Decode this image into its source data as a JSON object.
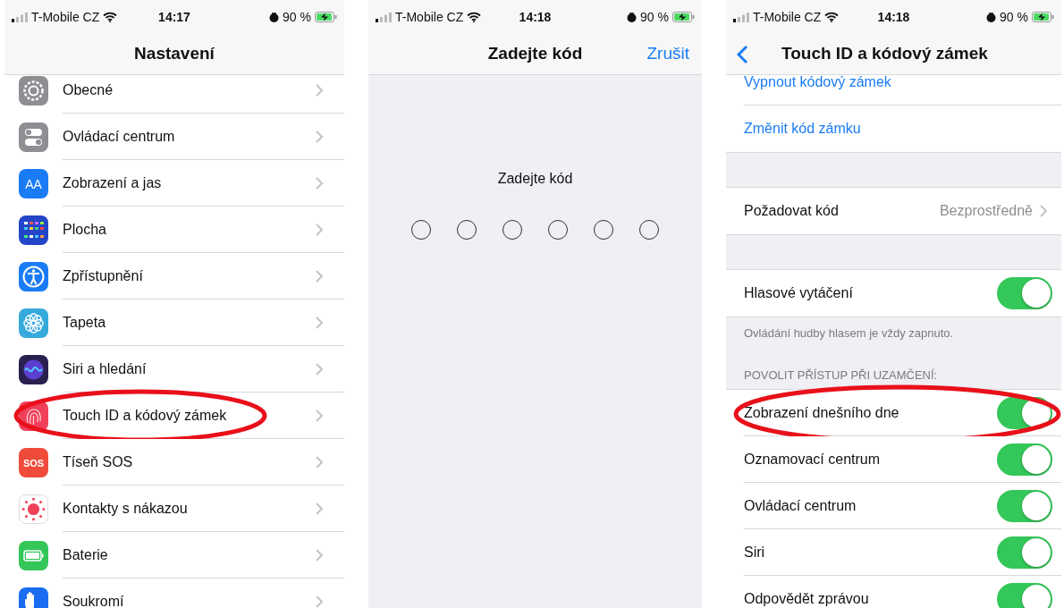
{
  "screens": [
    {
      "kind": "settings",
      "status_bar": {
        "carrier": "T-Mobile CZ",
        "time": "14:17",
        "battery": "90 %"
      },
      "title": "Nastavení",
      "items": [
        {
          "label": "Obecné",
          "color": "#8e8e93",
          "highlighted": false
        },
        {
          "label": "Ovládací centrum",
          "color": "#8e8e93",
          "highlighted": false
        },
        {
          "label": "Zobrazení a jas",
          "color": "#1a7cf5",
          "icon_text": "AA",
          "highlighted": false
        },
        {
          "label": "Plocha",
          "color": "#2346c9",
          "highlighted": false
        },
        {
          "label": "Zpřístupnění",
          "color": "#1a7cf5",
          "highlighted": false
        },
        {
          "label": "Tapeta",
          "color": "#36aadc",
          "highlighted": false
        },
        {
          "label": "Siri a hledání",
          "color": "#2a2050",
          "highlighted": false
        },
        {
          "label": "Touch ID a kódový zámek",
          "color": "#f0405a",
          "highlighted": true
        },
        {
          "label": "Tíseň SOS",
          "color": "#f04a3a",
          "icon_text": "SOS",
          "highlighted": false
        },
        {
          "label": "Kontakty s nákazou",
          "color": "#ffffff",
          "highlighted": false
        },
        {
          "label": "Baterie",
          "color": "#34c659",
          "highlighted": false
        },
        {
          "label": "Soukromí",
          "color": "#1a6cf0",
          "highlighted": false
        }
      ]
    },
    {
      "kind": "passcode",
      "status_bar": {
        "carrier": "T-Mobile CZ",
        "time": "14:18",
        "battery": "90 %"
      },
      "title": "Zadejte kód",
      "action": "Zrušit",
      "prompt": "Zadejte kód",
      "dots": [
        {
          "filled": false
        },
        {
          "filled": false
        },
        {
          "filled": false
        },
        {
          "filled": false
        },
        {
          "filled": false
        },
        {
          "filled": false
        }
      ]
    },
    {
      "kind": "detail",
      "status_bar": {
        "carrier": "T-Mobile CZ",
        "time": "14:18",
        "battery": "90 %"
      },
      "title": "Touch ID a kódový zámek",
      "groups": [
        {
          "rows": [
            {
              "kind": "link",
              "label": "Vypnout kódový zámek",
              "highlighted": false
            },
            {
              "kind": "link",
              "label": "Změnit kód zámku",
              "highlighted": false
            }
          ]
        },
        {
          "rows": [
            {
              "kind": "value",
              "label": "Požadovat kód",
              "value": "Bezprostředně",
              "highlighted": false
            }
          ]
        },
        {
          "rows": [
            {
              "kind": "toggle",
              "label": "Hlasové vytáčení",
              "on": true,
              "highlighted": false
            }
          ],
          "footer": "Ovládání hudby hlasem je vždy zapnuto."
        },
        {
          "header": "POVOLIT PŘÍSTUP PŘI UZAMČENÍ:",
          "rows": [
            {
              "kind": "toggle",
              "label": "Zobrazení dnešního dne",
              "on": true,
              "highlighted": true
            },
            {
              "kind": "toggle",
              "label": "Oznamovací centrum",
              "on": true,
              "highlighted": false
            },
            {
              "kind": "toggle",
              "label": "Ovládací centrum",
              "on": true,
              "highlighted": false
            },
            {
              "kind": "toggle",
              "label": "Siri",
              "on": true,
              "highlighted": false
            },
            {
              "kind": "toggle",
              "label": "Odpovědět zprávou",
              "on": true,
              "highlighted": false
            }
          ]
        }
      ]
    }
  ]
}
